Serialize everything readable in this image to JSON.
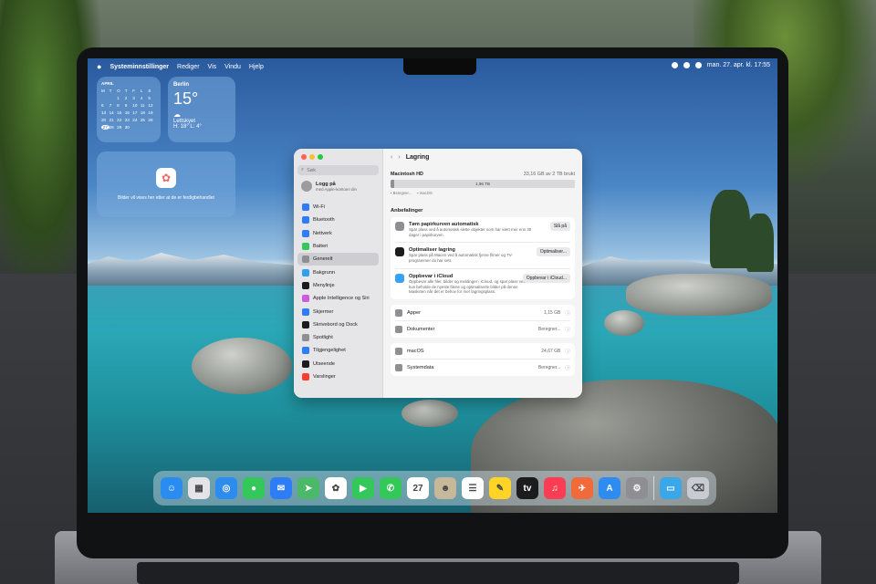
{
  "menubar": {
    "apple_icon": "apple-icon",
    "items": [
      "Systeminnstillinger",
      "Rediger",
      "Vis",
      "Vindu",
      "Hjelp"
    ],
    "clock": "man. 27. apr. kl. 17:55"
  },
  "widgets": {
    "calendar": {
      "month": "APRIL",
      "weekdays": [
        "M",
        "T",
        "O",
        "T",
        "F",
        "L",
        "S"
      ],
      "days": [
        "",
        "",
        "1",
        "2",
        "3",
        "4",
        "5",
        "6",
        "7",
        "8",
        "9",
        "10",
        "11",
        "12",
        "13",
        "14",
        "15",
        "16",
        "17",
        "18",
        "19",
        "20",
        "21",
        "22",
        "23",
        "24",
        "25",
        "26",
        "27",
        "28",
        "29",
        "30",
        "",
        "",
        ""
      ]
    },
    "weather": {
      "city": "Berlin",
      "temp": "15°",
      "condition": "Lettskyet",
      "range": "H: 18° L: 4°"
    },
    "photos": {
      "text": "Bilder vil vises her etter at de er ferdigbehandlet"
    }
  },
  "window": {
    "search_placeholder": "Søk",
    "user": {
      "name": "Logg på",
      "subtitle": "med Apple-kontoen din"
    },
    "sidebar": [
      {
        "label": "Wi-Fi",
        "color": "#2e7cf6",
        "active": false
      },
      {
        "label": "Bluetooth",
        "color": "#2e7cf6",
        "active": false
      },
      {
        "label": "Nettverk",
        "color": "#2e7cf6",
        "active": false
      },
      {
        "label": "Batteri",
        "color": "#34c759",
        "active": false
      },
      {
        "label": "Generelt",
        "color": "#8e8e93",
        "active": true
      },
      {
        "label": "Bakgrunn",
        "color": "#2ea0f0",
        "active": false
      },
      {
        "label": "Menylinje",
        "color": "#1c1c1e",
        "active": false
      },
      {
        "label": "Apple Intelligence og Siri",
        "color": "#d05be0",
        "active": false
      },
      {
        "label": "Skjermer",
        "color": "#2e7cf6",
        "active": false
      },
      {
        "label": "Skrivebord og Dock",
        "color": "#1c1c1e",
        "active": false
      },
      {
        "label": "Spotlight",
        "color": "#8e8e93",
        "active": false
      },
      {
        "label": "Tilgjengelighet",
        "color": "#2e7cf6",
        "active": false
      },
      {
        "label": "Utseende",
        "color": "#1c1c1e",
        "active": false
      },
      {
        "label": "Varslinger",
        "color": "#ff3b30",
        "active": false
      }
    ],
    "title": "Lagring",
    "disk": {
      "name": "Macintosh HD",
      "usage": "33,16 GB av 2 TB brukt",
      "free": "1,96 TB",
      "free_fraction": 0.98,
      "legend": [
        "Beregner...",
        "macOS"
      ]
    },
    "recommendations_title": "Anbefalinger",
    "recommendations": [
      {
        "title": "Tøm papirkurven automatisk",
        "desc": "Spar plass ved å automatisk slette objekter som har vært mer enn 30 dager i papirkurven.",
        "button": "Slå på",
        "icon": "trash-icon",
        "color": "#8e8e93"
      },
      {
        "title": "Optimaliser lagring",
        "desc": "Spar plass på Macen ved å automatisk fjerne filmer og TV-programmer du har sett.",
        "button": "Optimaliser...",
        "icon": "appletv-icon",
        "color": "#1c1c1e"
      },
      {
        "title": "Oppbevar i iCloud",
        "desc": "Oppbevar alle filer, bilder og meldinger i iCloud, og spar plass ved å kun beholde de nyeste filene og optimaliserte bilder på denne Maskinen når det er behov for mer lagringsplass.",
        "button": "Oppbevar i iCloud...",
        "icon": "icloud-icon",
        "color": "#3aa0f5"
      }
    ],
    "categories_a": [
      {
        "label": "Apper",
        "value": "1,15 GB"
      },
      {
        "label": "Dokumenter",
        "value": "Beregner..."
      }
    ],
    "categories_b": [
      {
        "label": "macOS",
        "value": "24,67 GB"
      },
      {
        "label": "Systemdata",
        "value": "Beregner..."
      }
    ]
  },
  "dock": {
    "apps": [
      {
        "name": "finder-icon",
        "glyph": "☺",
        "color": "#2a8cf0"
      },
      {
        "name": "launchpad-icon",
        "glyph": "▦",
        "color": "#e4e4e8"
      },
      {
        "name": "safari-icon",
        "glyph": "◎",
        "color": "#2e8cf0"
      },
      {
        "name": "messages-icon",
        "glyph": "●",
        "color": "#34c759"
      },
      {
        "name": "mail-icon",
        "glyph": "✉",
        "color": "#2e7cf6"
      },
      {
        "name": "maps-icon",
        "glyph": "➤",
        "color": "#4cb86a"
      },
      {
        "name": "photos-icon",
        "glyph": "✿",
        "color": "#ffffff"
      },
      {
        "name": "facetime-icon",
        "glyph": "▶",
        "color": "#34c759"
      },
      {
        "name": "phone-icon",
        "glyph": "✆",
        "color": "#34c759"
      },
      {
        "name": "calendar-icon",
        "glyph": "27",
        "color": "#ffffff"
      },
      {
        "name": "contacts-icon",
        "glyph": "☻",
        "color": "#c8b89a"
      },
      {
        "name": "reminders-icon",
        "glyph": "☰",
        "color": "#ffffff"
      },
      {
        "name": "notes-icon",
        "glyph": "✎",
        "color": "#ffd426"
      },
      {
        "name": "tv-icon",
        "glyph": "tv",
        "color": "#1c1c1e"
      },
      {
        "name": "music-icon",
        "glyph": "♫",
        "color": "#fa3c55"
      },
      {
        "name": "rocket-icon",
        "glyph": "✈",
        "color": "#f06a3a"
      },
      {
        "name": "appstore-icon",
        "glyph": "A",
        "color": "#2e8cf0"
      },
      {
        "name": "settings-icon",
        "glyph": "⚙",
        "color": "#8e8e93"
      },
      {
        "name": "folder-icon",
        "glyph": "▭",
        "color": "#3aa7e8"
      },
      {
        "name": "trash-icon",
        "glyph": "⌫",
        "color": "#c8ccd2"
      }
    ]
  }
}
